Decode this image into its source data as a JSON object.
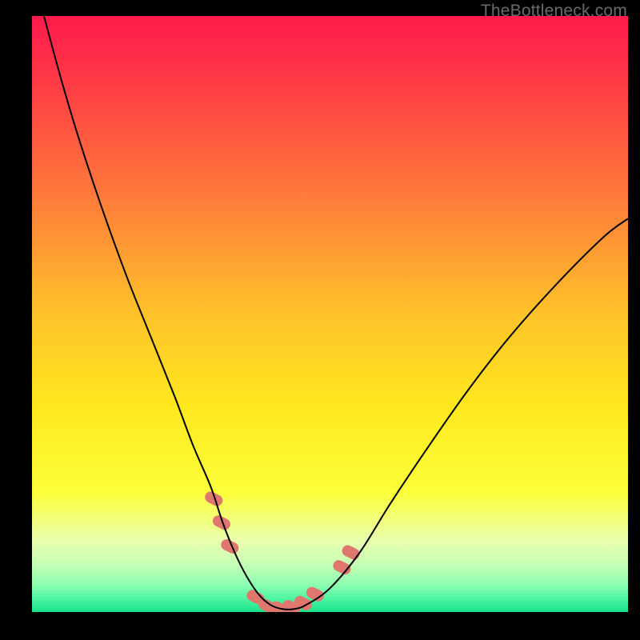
{
  "watermark": "TheBottleneck.com",
  "chart_data": {
    "type": "line",
    "title": "",
    "xlabel": "",
    "ylabel": "",
    "xlim": [
      0,
      100
    ],
    "ylim": [
      0,
      100
    ],
    "grid": false,
    "legend": false,
    "annotations": [],
    "background": {
      "type": "vertical-gradient",
      "stops": [
        {
          "pos": 0.0,
          "color": "#ff1a4b"
        },
        {
          "pos": 0.12,
          "color": "#ff3e46"
        },
        {
          "pos": 0.3,
          "color": "#ff7a3a"
        },
        {
          "pos": 0.5,
          "color": "#ffc22a"
        },
        {
          "pos": 0.66,
          "color": "#ffe91e"
        },
        {
          "pos": 0.8,
          "color": "#fbff3a"
        },
        {
          "pos": 0.88,
          "color": "#eaffad"
        },
        {
          "pos": 0.92,
          "color": "#c6ffb6"
        },
        {
          "pos": 0.955,
          "color": "#8bffb0"
        },
        {
          "pos": 0.975,
          "color": "#55f7a6"
        },
        {
          "pos": 1.0,
          "color": "#17e38a"
        }
      ]
    },
    "series": [
      {
        "name": "bottleneck-curve",
        "color": "#000000",
        "stroke_width": 2,
        "x": [
          2,
          5,
          8,
          12,
          16,
          20,
          24,
          27,
          30,
          32,
          34,
          36,
          38,
          40,
          42,
          44,
          46,
          50,
          55,
          60,
          66,
          73,
          80,
          88,
          96,
          100
        ],
        "y": [
          100,
          89,
          79,
          67,
          56,
          46,
          36,
          28,
          21,
          15,
          10,
          6,
          3,
          1.2,
          0.5,
          0.5,
          1.2,
          4,
          10,
          18,
          27,
          37,
          46,
          55,
          63,
          66
        ]
      }
    ],
    "markers": {
      "name": "highlight-dots",
      "color": "#e0776f",
      "radius": 7,
      "points": [
        {
          "x": 30.5,
          "y": 19
        },
        {
          "x": 31.8,
          "y": 15
        },
        {
          "x": 33.2,
          "y": 11
        },
        {
          "x": 37.5,
          "y": 2.5
        },
        {
          "x": 39.5,
          "y": 1.0
        },
        {
          "x": 41.5,
          "y": 0.6
        },
        {
          "x": 43.5,
          "y": 0.8
        },
        {
          "x": 45.5,
          "y": 1.5
        },
        {
          "x": 47.5,
          "y": 3.0
        },
        {
          "x": 52.0,
          "y": 7.5
        },
        {
          "x": 53.5,
          "y": 10.0
        }
      ]
    }
  }
}
